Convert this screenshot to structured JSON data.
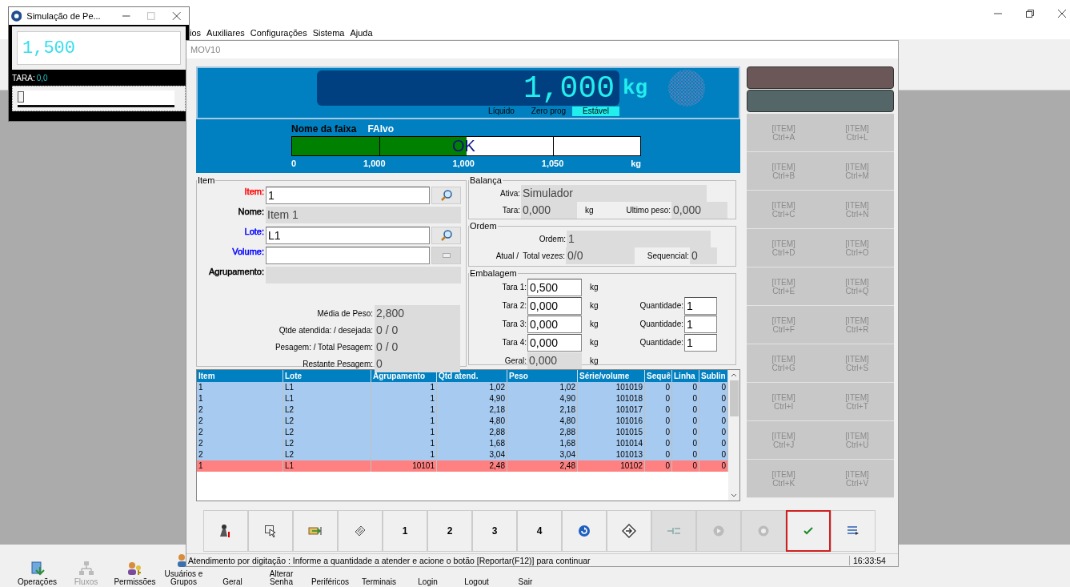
{
  "main_window": {
    "menu": [
      "ios",
      "Auxiliares",
      "Configurações",
      "Sistema",
      "Ajuda"
    ],
    "taskbar": [
      {
        "label": "Operações",
        "kind": "operations",
        "disabled": false
      },
      {
        "label": "Fluxos",
        "kind": "flows",
        "disabled": true
      },
      {
        "label": "Permissões",
        "kind": "permissions",
        "disabled": false
      },
      {
        "label": "Usuários e Grupos",
        "kind": "users",
        "disabled": false
      },
      {
        "label": "Geral",
        "kind": "plain",
        "disabled": false
      },
      {
        "label": "Alterar Senha",
        "kind": "plain",
        "disabled": false
      },
      {
        "label": "Periféricos",
        "kind": "plain",
        "disabled": false
      },
      {
        "label": "Terminais",
        "kind": "plain",
        "disabled": false
      },
      {
        "label": "Login",
        "kind": "plain",
        "disabled": false
      },
      {
        "label": "Logout",
        "kind": "plain",
        "disabled": false
      },
      {
        "label": "Sair",
        "kind": "plain",
        "disabled": false
      }
    ]
  },
  "simulator_window": {
    "title": "Simulação de Pe...",
    "weight": "1,500",
    "tare_label": "TARA:",
    "tare_value": "0,0",
    "slider": {
      "level": 0
    }
  },
  "dialog": {
    "title": "MOV10",
    "display": {
      "weight": "1,000",
      "unit": "kg",
      "indicators": [
        {
          "label": "Líquido",
          "on": false
        },
        {
          "label": "Zero prog",
          "on": false
        },
        {
          "label": "Estável",
          "on": true
        }
      ]
    },
    "range": {
      "label": "Nome da faixa",
      "name": "FAlvo",
      "level": 0.5,
      "status": "OK",
      "ticks": [
        "0",
        "1,000",
        "1,000",
        "1,050",
        "kg"
      ]
    },
    "item_group": {
      "title": "Item",
      "fields": [
        {
          "label": "Item:",
          "color": "#ff0000",
          "kind": "search",
          "value": "1"
        },
        {
          "label": "Nome:",
          "color": "#000000",
          "kind": "readonly",
          "value": "Item 1"
        },
        {
          "label": "Lote:",
          "color": "#0000ff",
          "kind": "search",
          "value": "L1"
        },
        {
          "label": "Volume:",
          "color": "#0000ff",
          "kind": "picker"
        },
        {
          "label": "Agrupamento:",
          "color": "#000000",
          "kind": "readonly"
        }
      ],
      "stats": [
        {
          "label": "Média de Peso:",
          "value": "2,800"
        },
        {
          "label": "Qtde atendida: / desejada:",
          "value": "0 / 0"
        },
        {
          "label": "Pesagem: / Total Pesagem:",
          "value": "0 / 0"
        },
        {
          "label": "Restante Pesagem:",
          "value": "0"
        }
      ]
    },
    "scale_group": {
      "title": "Balança",
      "active_label": "Ativa:",
      "active_value": "Simulador",
      "tare_label": "Tara:",
      "tare_value": "0,000",
      "tare_unit": "kg",
      "last_label": "Ultimo peso:",
      "last_value": "0,000"
    },
    "order_group": {
      "title": "Ordem",
      "order_label": "Ordem:",
      "order_value": "1",
      "current_label": "Atual /",
      "total_label": "Total vezes:",
      "total_value": "0/0",
      "sequence_label": "Sequencial:",
      "sequence_value": "0"
    },
    "packaging_group": {
      "title": "Embalagem",
      "tares": [
        {
          "label": "Tara 1:",
          "value": "0,500",
          "unit": "kg"
        },
        {
          "label": "Tara 2:",
          "value": "0,000",
          "unit": "kg",
          "quantity_label": "Quantidade:",
          "quantity": "1"
        },
        {
          "label": "Tara 3:",
          "value": "0,000",
          "unit": "kg",
          "quantity_label": "Quantidade:",
          "quantity": "1"
        },
        {
          "label": "Tara 4:",
          "value": "0,000",
          "unit": "kg",
          "quantity_label": "Quantidade:",
          "quantity": "1"
        }
      ],
      "total_label": "Geral:",
      "total_value": "0,000",
      "total_unit": "kg"
    },
    "table": {
      "columns": [
        "Item",
        "Lote",
        "Agrupamento",
        "Qtd atend.",
        "Peso",
        "Série/volume",
        "Sequê",
        "Linha",
        "Sublin"
      ],
      "rows": [
        {
          "color": "#a6caf0",
          "cells": [
            "1",
            "L1",
            "1",
            "1,02",
            "1,02",
            "101019",
            "0",
            "0",
            "0"
          ]
        },
        {
          "color": "#a6caf0",
          "cells": [
            "1",
            "L1",
            "1",
            "4,90",
            "4,90",
            "101018",
            "0",
            "0",
            "0"
          ]
        },
        {
          "color": "#a6caf0",
          "cells": [
            "2",
            "L2",
            "1",
            "2,18",
            "2,18",
            "101017",
            "0",
            "0",
            "0"
          ]
        },
        {
          "color": "#a6caf0",
          "cells": [
            "2",
            "L2",
            "1",
            "4,80",
            "4,80",
            "101016",
            "0",
            "0",
            "0"
          ]
        },
        {
          "color": "#a6caf0",
          "cells": [
            "2",
            "L2",
            "1",
            "2,88",
            "2,88",
            "101015",
            "0",
            "0",
            "0"
          ]
        },
        {
          "color": "#a6caf0",
          "cells": [
            "2",
            "L2",
            "1",
            "1,68",
            "1,68",
            "101014",
            "0",
            "0",
            "0"
          ]
        },
        {
          "color": "#a6caf0",
          "cells": [
            "2",
            "L2",
            "1",
            "3,04",
            "3,04",
            "101013",
            "0",
            "0",
            "0"
          ]
        },
        {
          "color": "#ff8080",
          "cells": [
            "1",
            "L1",
            "10101",
            "2,48",
            "2,48",
            "10102",
            "0",
            "0",
            "0"
          ]
        }
      ]
    },
    "side_buttons": [
      {
        "color": "#6b5757"
      },
      {
        "color": "#556668"
      }
    ],
    "shortcuts": [
      {
        "label": "[ITEM]",
        "key": "Ctrl+A",
        "disabled": true
      },
      {
        "label": "[ITEM]",
        "key": "Ctrl+L",
        "disabled": true
      },
      {
        "label": "[ITEM]",
        "key": "Ctrl+B",
        "disabled": true
      },
      {
        "label": "[ITEM]",
        "key": "Ctrl+M",
        "disabled": true
      },
      {
        "label": "[ITEM]",
        "key": "Ctrl+C",
        "disabled": true
      },
      {
        "label": "[ITEM]",
        "key": "Ctrl+N",
        "disabled": true
      },
      {
        "label": "[ITEM]",
        "key": "Ctrl+D",
        "disabled": true
      },
      {
        "label": "[ITEM]",
        "key": "Ctrl+O",
        "disabled": true
      },
      {
        "label": "[ITEM]",
        "key": "Ctrl+E",
        "disabled": true
      },
      {
        "label": "[ITEM]",
        "key": "Ctrl+Q",
        "disabled": true
      },
      {
        "label": "[ITEM]",
        "key": "Ctrl+F",
        "disabled": true
      },
      {
        "label": "[ITEM]",
        "key": "Ctrl+R",
        "disabled": true
      },
      {
        "label": "[ITEM]",
        "key": "Ctrl+G",
        "disabled": true
      },
      {
        "label": "[ITEM]",
        "key": "Ctrl+S",
        "disabled": true
      },
      {
        "label": "[ITEM]",
        "key": "Ctrl+I",
        "disabled": true
      },
      {
        "label": "[ITEM]",
        "key": "Ctrl+T",
        "disabled": true
      },
      {
        "label": "[ITEM]",
        "key": "Ctrl+J",
        "disabled": true
      },
      {
        "label": "[ITEM]",
        "key": "Ctrl+U",
        "disabled": true
      },
      {
        "label": "[ITEM]",
        "key": "Ctrl+K",
        "disabled": true
      },
      {
        "label": "[ITEM]",
        "key": "Ctrl+V",
        "disabled": true
      }
    ],
    "toolbar": [
      {
        "kind": "user",
        "disabled": false,
        "focused": false
      },
      {
        "kind": "pointer",
        "disabled": false,
        "focused": false
      },
      {
        "kind": "enter",
        "disabled": false,
        "focused": false
      },
      {
        "kind": "note",
        "disabled": false,
        "focused": false
      },
      {
        "kind": "number",
        "label": "1",
        "disabled": false,
        "focused": false
      },
      {
        "kind": "number",
        "label": "2",
        "disabled": false,
        "focused": false
      },
      {
        "kind": "number",
        "label": "3",
        "disabled": false,
        "focused": false
      },
      {
        "kind": "number",
        "label": "4",
        "disabled": false,
        "focused": false
      },
      {
        "kind": "refresh",
        "disabled": false,
        "focused": false
      },
      {
        "kind": "navigate",
        "disabled": false,
        "focused": false
      },
      {
        "kind": "split",
        "disabled": true,
        "focused": false
      },
      {
        "kind": "play",
        "disabled": true,
        "focused": false
      },
      {
        "kind": "record",
        "disabled": true,
        "focused": false
      },
      {
        "kind": "confirm",
        "disabled": false,
        "focused": true
      },
      {
        "kind": "list",
        "disabled": false,
        "focused": false
      }
    ],
    "status_bar": {
      "message": "Atendimento por digitação : Informe a quantidade a atender e acione o botão [Reportar(F12)] para continuar",
      "time": "16:33:54"
    }
  }
}
